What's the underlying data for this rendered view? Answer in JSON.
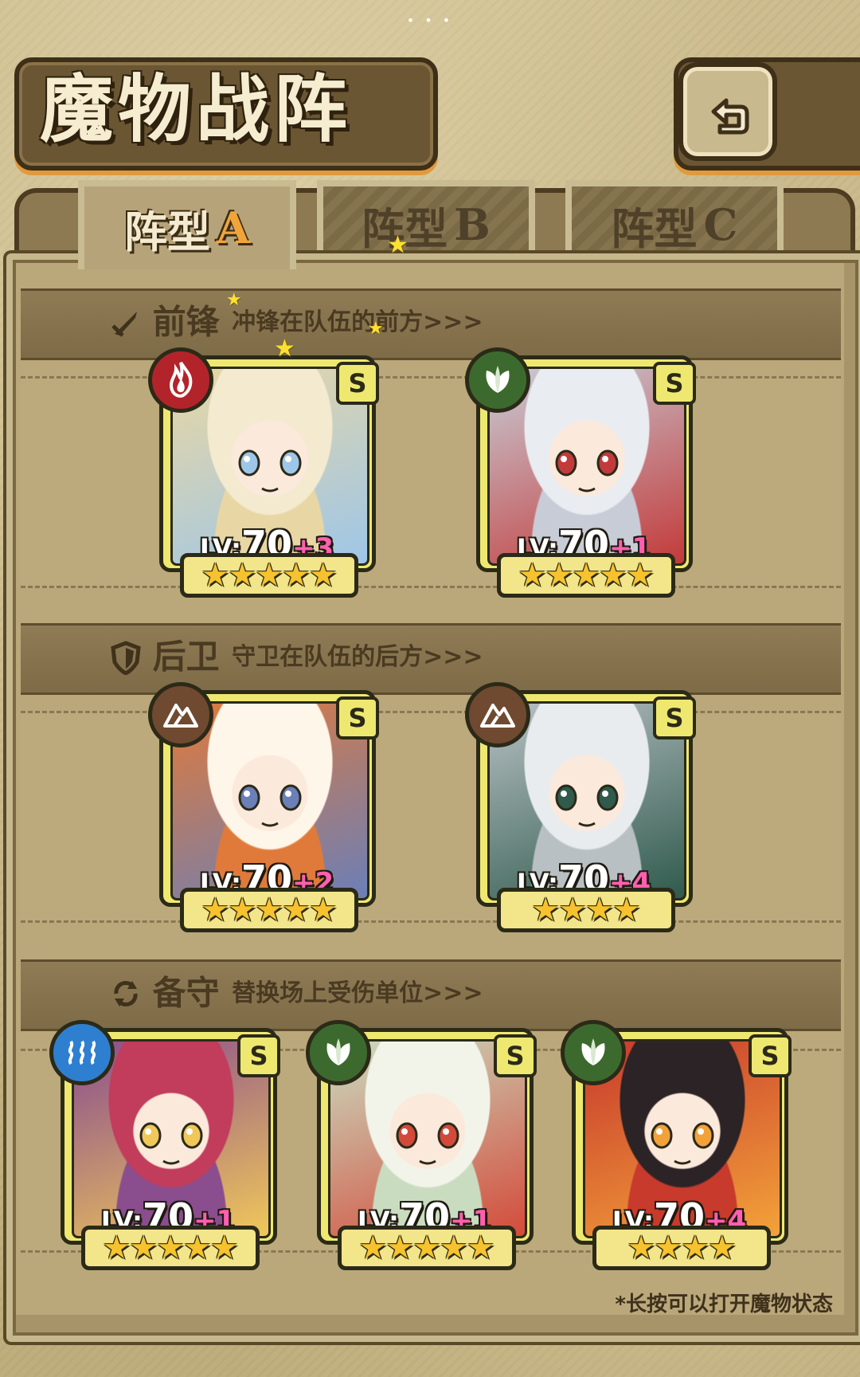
{
  "header": {
    "title": "魔物战阵",
    "back_icon": "back-arrow-icon"
  },
  "tabs": [
    {
      "label": "阵型",
      "letter": "A",
      "active": true
    },
    {
      "label": "阵型",
      "letter": "B",
      "active": false
    },
    {
      "label": "阵型",
      "letter": "C",
      "active": false
    }
  ],
  "sections": [
    {
      "name": "前锋",
      "desc": "冲锋在队伍的前方>>>",
      "icon": "sword-icon"
    },
    {
      "name": "后卫",
      "desc": "守卫在队伍的后方>>>",
      "icon": "shield-icon"
    },
    {
      "name": "备守",
      "desc": "替换场上受伤单位>>>",
      "icon": "swap-icon"
    }
  ],
  "element_colors": {
    "fire": "#b3242a",
    "nature": "#3c6a2e",
    "earth": "#6f4a30",
    "water": "#2f7fd0"
  },
  "monsters": [
    {
      "slot": "vanguard",
      "element": "fire",
      "rank": "S",
      "lv_prefix": "LV:",
      "lv": "70",
      "plus": "+3",
      "stars": 5,
      "portrait_colors": [
        "#f4ead0",
        "#e8d7a4",
        "#9ec6e8"
      ]
    },
    {
      "slot": "vanguard",
      "element": "nature",
      "rank": "S",
      "lv_prefix": "LV:",
      "lv": "70",
      "plus": "+1",
      "stars": 5,
      "portrait_colors": [
        "#e9ecf1",
        "#c7ccd6",
        "#c33a3a"
      ]
    },
    {
      "slot": "rearguard",
      "element": "earth",
      "rank": "S",
      "lv_prefix": "LV:",
      "lv": "70",
      "plus": "+2",
      "stars": 5,
      "portrait_colors": [
        "#fff6ea",
        "#e07a3a",
        "#6b7fb8"
      ]
    },
    {
      "slot": "rearguard",
      "element": "earth",
      "rank": "S",
      "lv_prefix": "LV:",
      "lv": "70",
      "plus": "+4",
      "stars": 4,
      "portrait_colors": [
        "#e9ecef",
        "#b8c0c4",
        "#2f5a4c"
      ]
    },
    {
      "slot": "reserve",
      "element": "water",
      "rank": "S",
      "lv_prefix": "LV:",
      "lv": "70",
      "plus": "+1",
      "stars": 5,
      "portrait_colors": [
        "#c23c5c",
        "#8a4d8e",
        "#f0c85a"
      ]
    },
    {
      "slot": "reserve",
      "element": "nature",
      "rank": "S",
      "lv_prefix": "LV:",
      "lv": "70",
      "plus": "+1",
      "stars": 5,
      "portrait_colors": [
        "#f2f4ea",
        "#c9dcc0",
        "#d44a3a"
      ]
    },
    {
      "slot": "reserve",
      "element": "nature",
      "rank": "S",
      "lv_prefix": "LV:",
      "lv": "70",
      "plus": "+4",
      "stars": 4,
      "portrait_colors": [
        "#2b2325",
        "#c83a2c",
        "#f3a23a"
      ]
    }
  ],
  "footnote": "*长按可以打开魔物状态"
}
